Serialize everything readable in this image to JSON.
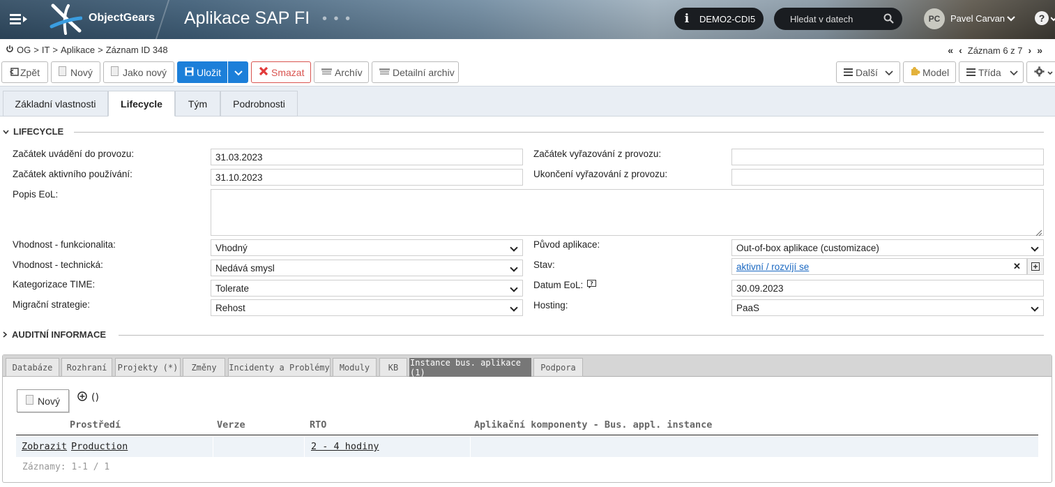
{
  "header": {
    "brand": "ObjectGears",
    "app_title": "Aplikace SAP FI",
    "app_dots": "• • •",
    "environment": "DEMO2-CDI5",
    "search_placeholder": "Hledat v datech",
    "user_initials": "PC",
    "user_name": "Pavel Carvan",
    "help": "?"
  },
  "breadcrumb": {
    "items": [
      "OG",
      "IT",
      "Aplikace",
      "Záznam ID 348"
    ],
    "sep": ">"
  },
  "record_nav": {
    "label": "Záznam 6 z 7"
  },
  "toolbar": {
    "back": "Zpět",
    "new": "Nový",
    "as_new": "Jako nový",
    "save": "Uložit",
    "delete": "Smazat",
    "archive": "Archív",
    "detail_archive": "Detailní archiv",
    "more": "Další",
    "model": "Model",
    "class": "Třída"
  },
  "tabs": [
    "Základní vlastnosti",
    "Lifecycle",
    "Tým",
    "Podrobnosti"
  ],
  "active_tab": "Lifecycle",
  "lifecycle": {
    "section_title": "LIFECYCLE",
    "start_deploy_label": "Začátek uvádění do provozu:",
    "start_deploy_value": "31.03.2023",
    "start_active_label": "Začátek aktivního používání:",
    "start_active_value": "31.10.2023",
    "eol_desc_label": "Popis EoL:",
    "eol_desc_value": "",
    "start_retire_label": "Začátek vyřazování z provozu:",
    "start_retire_value": "",
    "end_retire_label": "Ukončení vyřazování z provozu:",
    "end_retire_value": "",
    "func_fit_label": "Vhodnost - funkcionalita:",
    "func_fit_value": "Vhodný",
    "tech_fit_label": "Vhodnost - technická:",
    "tech_fit_value": "Nedává smysl",
    "time_label": "Kategorizace TIME:",
    "time_value": "Tolerate",
    "migration_label": "Migrační strategie:",
    "migration_value": "Rehost",
    "origin_label": "Původ aplikace:",
    "origin_value": "Out-of-box aplikace (customizace)",
    "status_label": "Stav:",
    "status_value": "aktivní / rozvíjí se",
    "eol_date_label": "Datum EoL:",
    "eol_date_value": "30.09.2023",
    "hosting_label": "Hosting:",
    "hosting_value": "PaaS"
  },
  "audit": {
    "section_title": "AUDITNÍ INFORMACE"
  },
  "subtabs": [
    "Databáze",
    "Rozhraní",
    "Projekty (*)",
    "Změny",
    "Incidenty a Problémy",
    "Moduly",
    "KB",
    "Instance bus. aplikace (1)",
    "Podpora"
  ],
  "active_subtab": "Instance bus. aplikace (1)",
  "subgrid": {
    "new_button": "Nový",
    "add_label": "()",
    "columns": [
      "Prostředí",
      "Verze",
      "RTO",
      "Aplikační komponenty - Bus. appl. instance"
    ],
    "rows": [
      {
        "action": "Zobrazit",
        "env": "Production",
        "version": "",
        "rto": "2 - 4 hodiny",
        "components": ""
      }
    ],
    "records": "Záznamy: 1-1 / 1"
  },
  "icons": [
    "menu-icon",
    "objectgears-logo",
    "info-icon",
    "search-icon",
    "chevron-down-icon",
    "help-icon",
    "power-icon",
    "first-page-icon",
    "prev-icon",
    "next-icon",
    "last-page-icon",
    "back-icon",
    "document-icon",
    "save-icon",
    "delete-icon",
    "archive-icon",
    "list-icon",
    "puzzle-icon",
    "gear-icon",
    "clear-icon",
    "add-icon",
    "help-box-icon",
    "add-circle-icon"
  ],
  "colors": {
    "primary": "#1c7fd9",
    "danger": "#d9534f",
    "header_dark": "#1a1d21",
    "link": "#1a68c2"
  }
}
